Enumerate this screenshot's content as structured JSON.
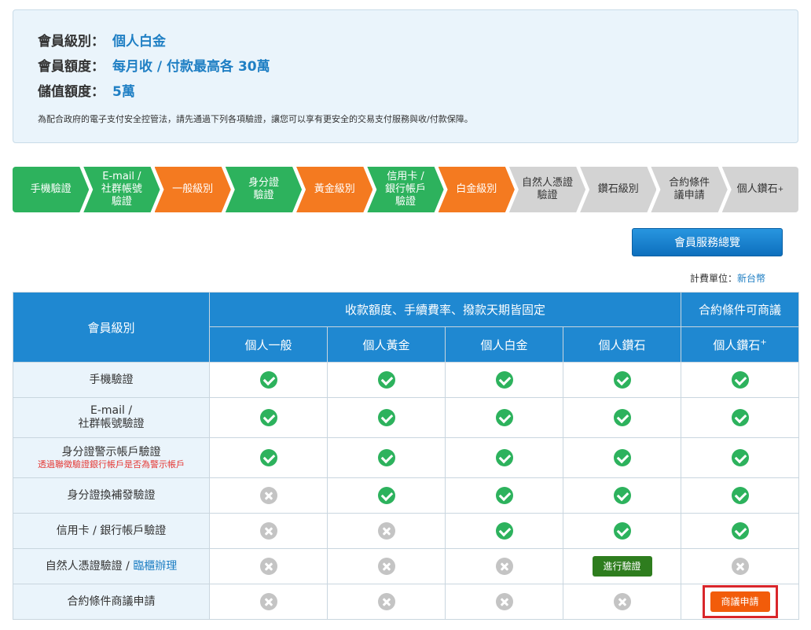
{
  "info": {
    "level_label": "會員級別：",
    "level_value": "個人白金",
    "quota_label": "會員額度：",
    "quota_value": "每月收 / 付款最高各 30萬",
    "stored_label": "儲值額度：",
    "stored_value": "5萬",
    "note": "為配合政府的電子支付安全控管法，請先通過下列各項驗證，讓您可以享有更安全的交易支付服務與收/付款保障。"
  },
  "steps": [
    {
      "label": "手機驗證",
      "state": "green"
    },
    {
      "label": "E-mail /\n社群帳號\n驗證",
      "state": "green"
    },
    {
      "label": "一般級別",
      "state": "orange"
    },
    {
      "label": "身分證\n驗證",
      "state": "green"
    },
    {
      "label": "黃金級別",
      "state": "orange"
    },
    {
      "label": "信用卡 /\n銀行帳戶\n驗證",
      "state": "green"
    },
    {
      "label": "白金級別",
      "state": "orange"
    },
    {
      "label": "自然人憑證\n驗證",
      "state": "gray"
    },
    {
      "label": "鑽石級別",
      "state": "gray"
    },
    {
      "label": "合約條件\n議申請",
      "state": "gray"
    },
    {
      "label": "個人鑽石",
      "sup": "+",
      "state": "gray"
    }
  ],
  "overview_button": "會員服務總覽",
  "unit": {
    "label": "計費單位：",
    "currency": "新台幣"
  },
  "table": {
    "corner": "會員級別",
    "group_fixed": "收款額度、手續費率、撥款天期皆固定",
    "group_negotiable": "合約條件可商議",
    "columns": [
      {
        "label": "個人一般"
      },
      {
        "label": "個人黃金"
      },
      {
        "label": "個人白金"
      },
      {
        "label": "個人鑽石"
      },
      {
        "label": "個人鑽石",
        "sup": "+"
      }
    ],
    "rows": [
      {
        "label": "手機驗證",
        "cells": [
          "yes",
          "yes",
          "yes",
          "yes",
          "yes"
        ]
      },
      {
        "label": "E-mail /\n社群帳號驗證",
        "cells": [
          "yes",
          "yes",
          "yes",
          "yes",
          "yes"
        ]
      },
      {
        "label": "身分證警示帳戶驗證",
        "sublabel": "透過聯徵驗證銀行帳戶是否為警示帳戶",
        "cells": [
          "yes",
          "yes",
          "yes",
          "yes",
          "yes"
        ]
      },
      {
        "label": "身分證換補發驗證",
        "cells": [
          "no",
          "yes",
          "yes",
          "yes",
          "yes"
        ]
      },
      {
        "label": "信用卡 / 銀行帳戶驗證",
        "cells": [
          "no",
          "no",
          "yes",
          "yes",
          "yes"
        ]
      },
      {
        "label": "自然人憑證驗證 / ",
        "link": "臨櫃辦理",
        "cells": [
          "no",
          "no",
          "no",
          "button:verify",
          "no"
        ]
      },
      {
        "label": "合約條件商議申請",
        "cells": [
          "no",
          "no",
          "no",
          "no",
          "button:nego"
        ]
      }
    ],
    "verify_button": "進行驗證",
    "nego_button": "商議申請"
  }
}
